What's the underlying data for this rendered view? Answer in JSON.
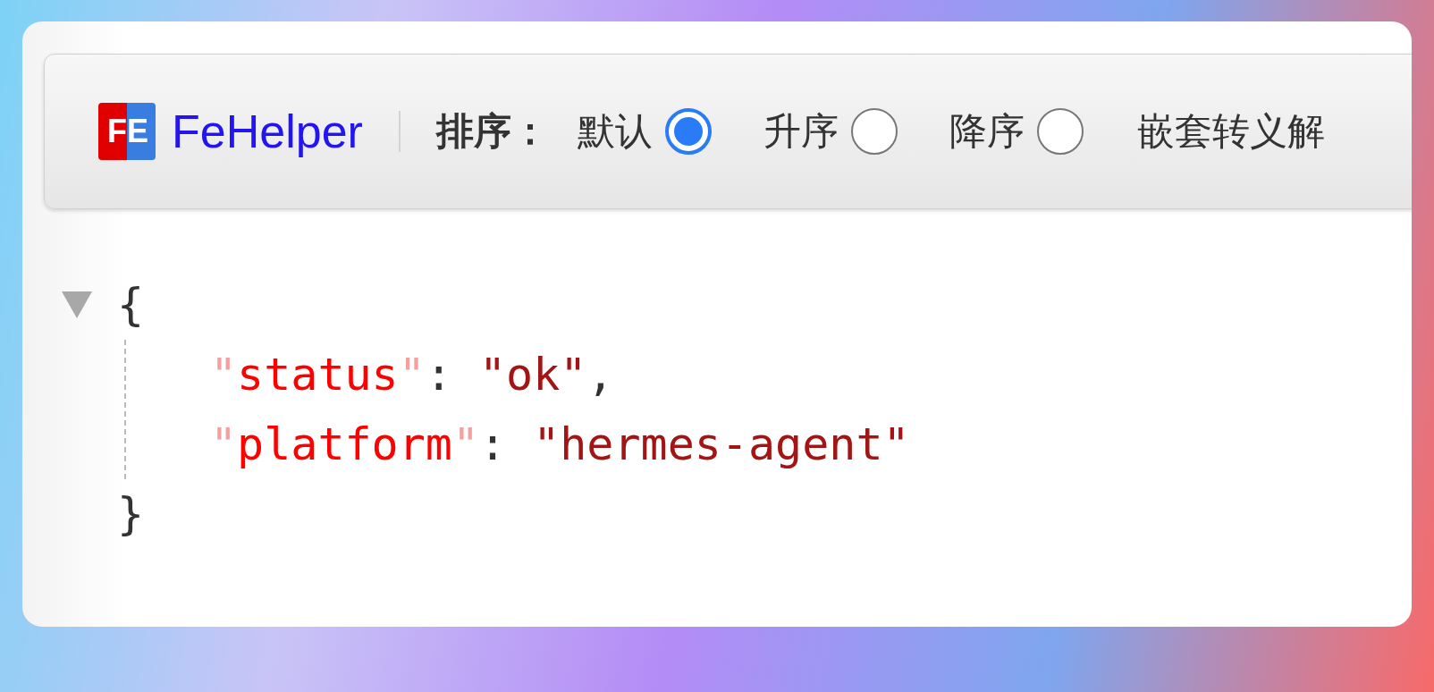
{
  "toolbar": {
    "logo": {
      "mark": "FE",
      "name": "FeHelper"
    },
    "sort_label": "排序：",
    "sort_options": [
      {
        "label": "默认",
        "selected": true
      },
      {
        "label": "升序",
        "selected": false
      },
      {
        "label": "降序",
        "selected": false
      }
    ],
    "nested_unescape_label": "嵌套转义解"
  },
  "json_view": {
    "expanded": true,
    "open_brace": "{",
    "close_brace": "}",
    "entries": [
      {
        "key": "\"status\"",
        "separator": ":",
        "value": "\"ok\"",
        "trailing": ","
      },
      {
        "key": "\"platform\"",
        "separator": ":",
        "value": "\"hermes-agent\""
      }
    ]
  }
}
